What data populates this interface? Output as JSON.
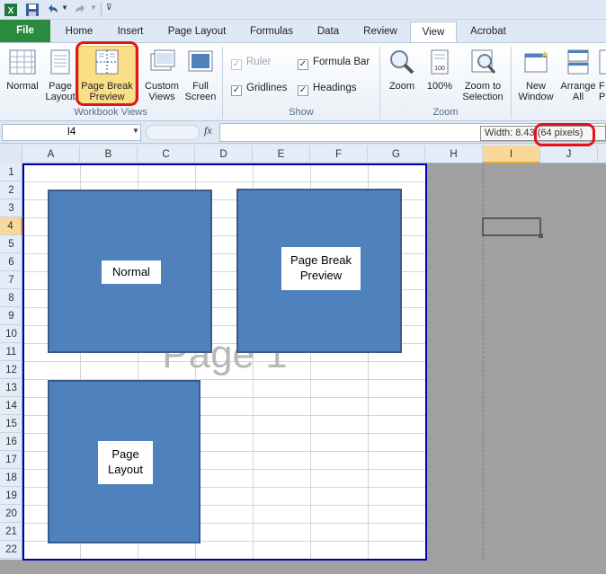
{
  "qat": {
    "icons": [
      "excel-icon",
      "save-icon",
      "undo-icon",
      "redo-icon",
      "customize-icon"
    ]
  },
  "tabs": [
    "File",
    "Home",
    "Insert",
    "Page Layout",
    "Formulas",
    "Data",
    "Review",
    "View",
    "Acrobat"
  ],
  "ribbon": {
    "workbook_views": {
      "normal_l1": "Normal",
      "page_layout_l1": "Page",
      "page_layout_l2": "Layout",
      "page_break_l1": "Page Break",
      "page_break_l2": "Preview",
      "custom_l1": "Custom",
      "custom_l2": "Views",
      "full_l1": "Full",
      "full_l2": "Screen",
      "group_label": "Workbook Views"
    },
    "show": {
      "ruler": "Ruler",
      "formula_bar": "Formula Bar",
      "gridlines": "Gridlines",
      "headings": "Headings",
      "group_label": "Show"
    },
    "zoom": {
      "zoom": "Zoom",
      "hundred": "100%",
      "zoom_sel_l1": "Zoom to",
      "zoom_sel_l2": "Selection",
      "group_label": "Zoom"
    },
    "window": {
      "new_l1": "New",
      "new_l2": "Window",
      "arrange_l1": "Arrange",
      "arrange_l2": "All",
      "freeze_l1": "F",
      "freeze_l2": "P"
    }
  },
  "formula_bar": {
    "name_box": "I4",
    "fx": "fx",
    "tooltip_width": "Width: 8.43",
    "tooltip_pixels": "(64 pixels)"
  },
  "columns": [
    "A",
    "B",
    "C",
    "D",
    "E",
    "F",
    "G",
    "H",
    "I",
    "J"
  ],
  "rows": [
    "1",
    "2",
    "3",
    "4",
    "5",
    "6",
    "7",
    "8",
    "9",
    "10",
    "11",
    "12",
    "13",
    "14",
    "15",
    "16",
    "17",
    "18",
    "19",
    "20",
    "21",
    "22"
  ],
  "page_watermark": "Page 1",
  "shapes": {
    "normal": "Normal",
    "page_break_l1": "Page Break",
    "page_break_l2": "Preview",
    "page_layout_l1": "Page",
    "page_layout_l2": "Layout"
  }
}
